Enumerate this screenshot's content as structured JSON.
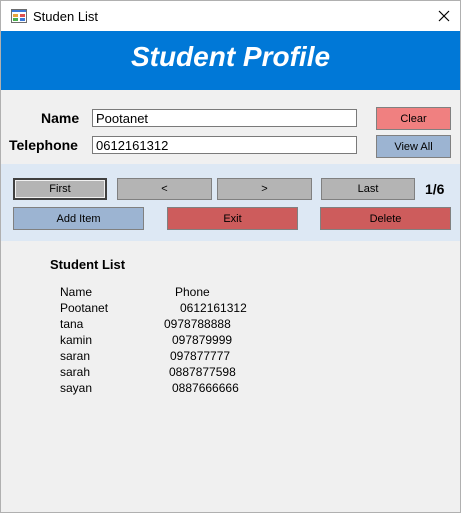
{
  "window": {
    "title": "Studen List"
  },
  "banner": {
    "title": "Student Profile"
  },
  "form": {
    "name_label": "Name",
    "name_value": "Pootanet",
    "telephone_label": "Telephone",
    "telephone_value": "0612161312"
  },
  "buttons": {
    "clear": "Clear",
    "view_all": "View All",
    "first": "First",
    "prev": "<",
    "next": ">",
    "last": "Last",
    "add_item": "Add Item",
    "exit": "Exit",
    "delete": "Delete"
  },
  "counter": "1/6",
  "list": {
    "title": "Student List",
    "header": {
      "name": "Name",
      "phone": "Phone"
    },
    "rows": [
      {
        "name": "Pootanet",
        "phone": "0612161312"
      },
      {
        "name": "tana",
        "phone": "0978788888"
      },
      {
        "name": "kamin",
        "phone": "097879999"
      },
      {
        "name": "saran",
        "phone": "097877777"
      },
      {
        "name": "sarah",
        "phone": "0887877598"
      },
      {
        "name": "sayan",
        "phone": "0887666666"
      }
    ]
  },
  "colors": {
    "banner": "#0078d7",
    "clear_button": "#f08080",
    "view_all_button": "#9cb4d2",
    "nav_button": "#b4b4b4",
    "add_item_button": "#9cb4d2",
    "exit_button": "#cd5c5c",
    "delete_button": "#cd5c5c",
    "nav_panel": "#dde8f4"
  }
}
